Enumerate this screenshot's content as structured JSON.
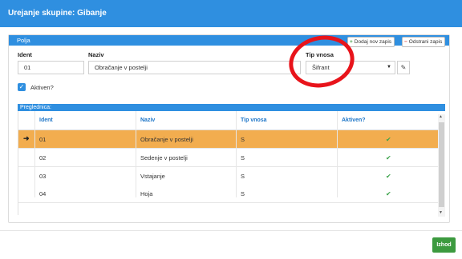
{
  "window": {
    "title": "Urejanje skupine: Gibanje"
  },
  "panel": {
    "title": "Polja",
    "add_button": "Dodaj nov zapis",
    "remove_button": "Odstrani zapis"
  },
  "form": {
    "ident_label": "Ident",
    "ident_value": "01",
    "naziv_label": "Naziv",
    "naziv_value": "Obračanje v postelji",
    "tip_label": "Tip vnosa",
    "tip_value": "Šifrant",
    "active_label": "Aktiven?",
    "active_checked": true
  },
  "grid": {
    "title": "Preglednica:",
    "columns": [
      "Ident",
      "Naziv",
      "Tip vnosa",
      "Aktiven?"
    ],
    "rows": [
      {
        "ident": "01",
        "naziv": "Obračanje v postelji",
        "tip": "S",
        "aktiven": true,
        "selected": true
      },
      {
        "ident": "02",
        "naziv": "Sedenje v postelji",
        "tip": "S",
        "aktiven": true,
        "selected": false
      },
      {
        "ident": "03",
        "naziv": "Vstajanje",
        "tip": "S",
        "aktiven": true,
        "selected": false
      },
      {
        "ident": "04",
        "naziv": "Hoja",
        "tip": "S",
        "aktiven": true,
        "selected": false
      }
    ]
  },
  "footer": {
    "exit_button": "Izhod"
  },
  "colors": {
    "accent": "#2f8fe0",
    "selected_row": "#f2ad4f",
    "exit": "#3c9a3f",
    "annotation": "#e8141b"
  }
}
